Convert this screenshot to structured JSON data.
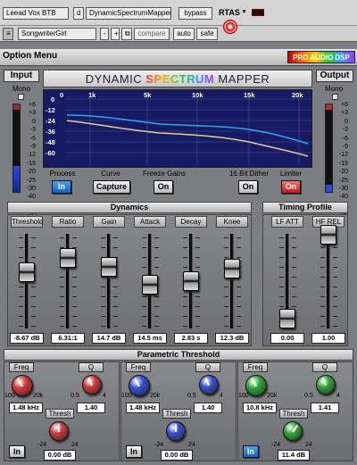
{
  "host": {
    "track": "Leead Vox BTB",
    "track_mode": "d",
    "plugin_name": "DynamicSpectrumMapper",
    "bypass": "bypass",
    "rtas": "RTAS",
    "preset": "SongwriterGirl",
    "minus": "-",
    "plus": "+",
    "compare": "compare",
    "auto": "auto",
    "safe": "safe"
  },
  "menu": {
    "option": "Option Menu",
    "brand": "PRO AUDIO DSP"
  },
  "input": {
    "label": "Input",
    "mono": "Mono"
  },
  "output": {
    "label": "Output",
    "mono": "Mono"
  },
  "meter_scale": [
    "+6",
    "+3",
    "0",
    "-3",
    "-6",
    "-9",
    "-12",
    "-15",
    "-20",
    "-25",
    "-30",
    "-40",
    "-50",
    "-60"
  ],
  "title": {
    "part1": "DYNAMIC ",
    "part2": "SPECTRUM",
    "part3": " MAPPER"
  },
  "graph": {
    "x_ticks": [
      "0",
      "1k",
      "5k",
      "10k",
      "15k",
      "20k"
    ],
    "y_ticks": [
      "0",
      "-12",
      "-24",
      "-36",
      "-48",
      "-60"
    ]
  },
  "controls": {
    "process": {
      "label": "Process",
      "value": "In"
    },
    "curve": {
      "label": "Curve",
      "value": "Capture"
    },
    "freeze": {
      "label": "Freeze Gains",
      "value": "On"
    },
    "dither": {
      "label": "16 Bit Dither",
      "value": "On"
    },
    "limiter": {
      "label": "Limiter",
      "value": "On"
    }
  },
  "dynamics": {
    "title": "Dynamics",
    "faders": [
      {
        "label": "Threshold",
        "value": "-8.67 dB"
      },
      {
        "label": "Ratio",
        "value": "6.31:1"
      },
      {
        "label": "Gain",
        "value": "14.7 dB"
      },
      {
        "label": "Attack",
        "value": "14.5 ms"
      },
      {
        "label": "Decay",
        "value": "2.83 s"
      },
      {
        "label": "Knee",
        "value": "12.3 dB"
      }
    ]
  },
  "timing": {
    "title": "Timing Profile",
    "faders": [
      {
        "label": "LF ATT",
        "value": "0.00"
      },
      {
        "label": "HF REL",
        "value": "1.00"
      }
    ]
  },
  "parametric": {
    "title": "Parametric Threshold",
    "bands": [
      {
        "freq_label": "Freq",
        "q_label": "Q",
        "thresh_label": "Thresh",
        "freq_value": "1.48 kHz",
        "q_value": "1.40",
        "thresh_value": "0.00 dB",
        "in_label": "In",
        "freq_min": "100",
        "freq_max": "20k",
        "q_min": "0.5",
        "q_max": "4",
        "th_min": "-24",
        "th_max": "24",
        "color": "#d23a3a"
      },
      {
        "freq_label": "Freq",
        "q_label": "Q",
        "thresh_label": "Thresh",
        "freq_value": "1.48 kHz",
        "q_value": "1.40",
        "thresh_value": "0.00 dB",
        "in_label": "In",
        "freq_min": "100",
        "freq_max": "20k",
        "q_min": "0.5",
        "q_max": "4",
        "th_min": "-24",
        "th_max": "24",
        "color": "#3a4fd2"
      },
      {
        "freq_label": "Freq",
        "q_label": "Q",
        "thresh_label": "Thresh",
        "freq_value": "10.8 kHz",
        "q_value": "1.41",
        "thresh_value": "11.4 dB",
        "in_label": "In",
        "freq_min": "100",
        "freq_max": "20k",
        "q_min": "0.5",
        "q_max": "4",
        "th_min": "-24",
        "th_max": "24",
        "color": "#2fa83a"
      }
    ]
  }
}
